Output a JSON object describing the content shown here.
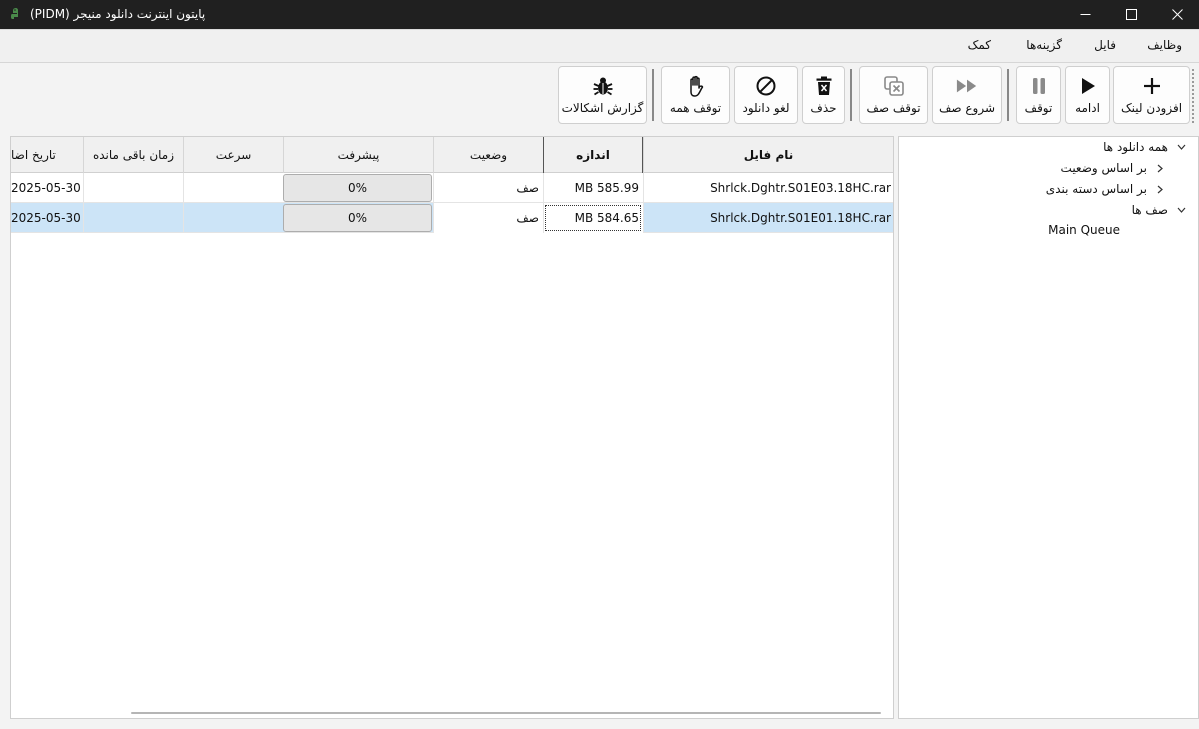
{
  "window": {
    "title": "(PIDM) پایتون اینترنت دانلود منیجر"
  },
  "menu": {
    "items": [
      "وظایف",
      "فایل",
      "گزینه‌ها",
      "کمک"
    ]
  },
  "toolbar": {
    "add_link": "افزودن لینک",
    "resume": "ادامه",
    "pause": "توقف",
    "start_queue": "شروع صف",
    "stop_queue": "توقف صف",
    "delete": "حذف",
    "cancel_download": "لغو دانلود",
    "stop_all": "توقف همه",
    "report_bugs": "گزارش اشکالات"
  },
  "table": {
    "columns": {
      "file_name": "نام فایل",
      "size": "اندازه",
      "status": "وضعیت",
      "progress": "پیشرفت",
      "speed": "سرعت",
      "time_left": "زمان باقی مانده",
      "date_added": "تاریخ اضا"
    },
    "rows": [
      {
        "file_name": "Shrlck.Dghtr.S01E03.18HC.rar",
        "size": "MB 585.99",
        "status": "صف",
        "progress": "0%",
        "progress_value": 0,
        "speed": "",
        "time_left": "",
        "date_added": "2025-05-30"
      },
      {
        "file_name": "Shrlck.Dghtr.S01E01.18HC.rar",
        "size": "MB 584.65",
        "status": "صف",
        "progress": "0%",
        "progress_value": 0,
        "speed": "",
        "time_left": "",
        "date_added": "2025-05-30"
      }
    ]
  },
  "tree": {
    "all_downloads": "همه دانلود ها",
    "by_status": "بر اساس وضعیت",
    "by_category": "بر اساس دسته بندی",
    "queues": "صف ها",
    "main_queue": "Main Queue"
  }
}
